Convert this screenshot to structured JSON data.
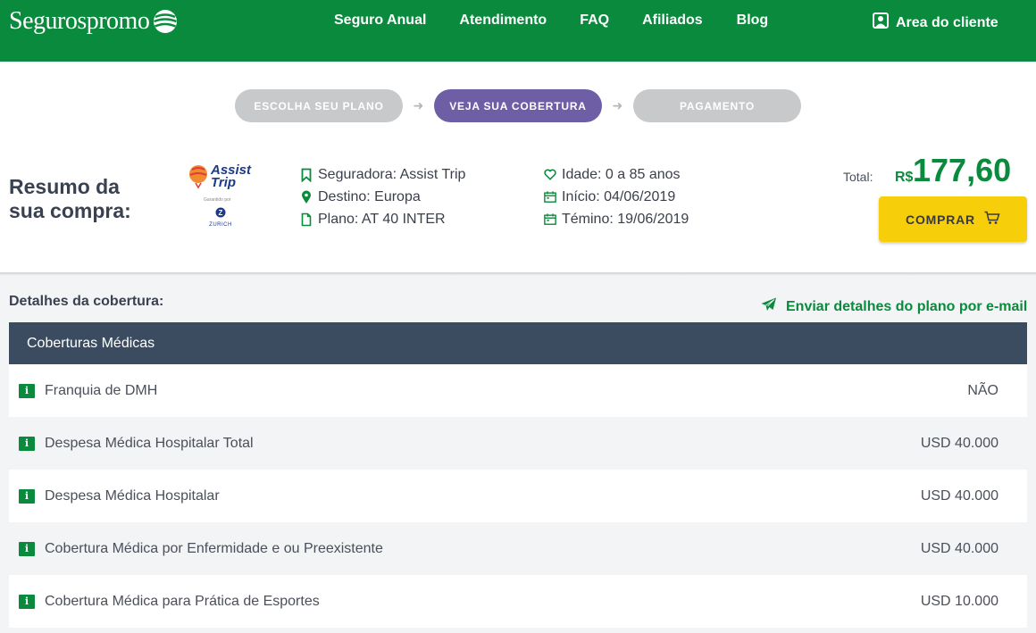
{
  "header": {
    "logo_text": "Segurospromo",
    "nav": [
      "Seguro Anual",
      "Atendimento",
      "FAQ",
      "Afiliados",
      "Blog"
    ],
    "client_area": "Area do cliente"
  },
  "steps": [
    {
      "label": "ESCOLHA SEU PLANO",
      "state": "inactive"
    },
    {
      "label": "VEJA SUA COBERTURA",
      "state": "active"
    },
    {
      "label": "PAGAMENTO",
      "state": "inactive"
    }
  ],
  "summary": {
    "title_line1": "Resumo da",
    "title_line2": "sua compra:",
    "insurer_logo": {
      "name": "Assist Trip",
      "line1": "Assist",
      "line2": "Trip",
      "guarantee": "Garantido por",
      "partner": "ZURICH"
    },
    "seguradora": "Seguradora: Assist Trip",
    "destino": "Destino: Europa",
    "plano": "Plano: AT 40 INTER",
    "idade": "Idade: 0 a 85 anos",
    "inicio": "Início: 04/06/2019",
    "termino": "Témino: 19/06/2019",
    "total_label": "Total:",
    "currency": "R$",
    "total_value": "177,60",
    "buy_label": "COMPRAR"
  },
  "details": {
    "title": "Detalhes da cobertura:",
    "send_email": "Enviar detalhes do plano por e-mail",
    "section_title": "Coberturas Médicas",
    "rows": [
      {
        "label": "Franquia de DMH",
        "value": "NÃO"
      },
      {
        "label": "Despesa Médica Hospitalar Total",
        "value": "USD 40.000"
      },
      {
        "label": "Despesa Médica Hospitalar",
        "value": "USD 40.000"
      },
      {
        "label": "Cobertura Médica por Enfermidade e ou Preexistente",
        "value": "USD 40.000"
      },
      {
        "label": "Cobertura Médica para Prática de Esportes",
        "value": "USD 10.000"
      }
    ]
  },
  "colors": {
    "brand_green": "#0a8a3c",
    "active_step": "#6d5ea6",
    "inactive_step": "#c8c9cb",
    "buy_button": "#f7ce0a",
    "table_header": "#3b4c60"
  }
}
